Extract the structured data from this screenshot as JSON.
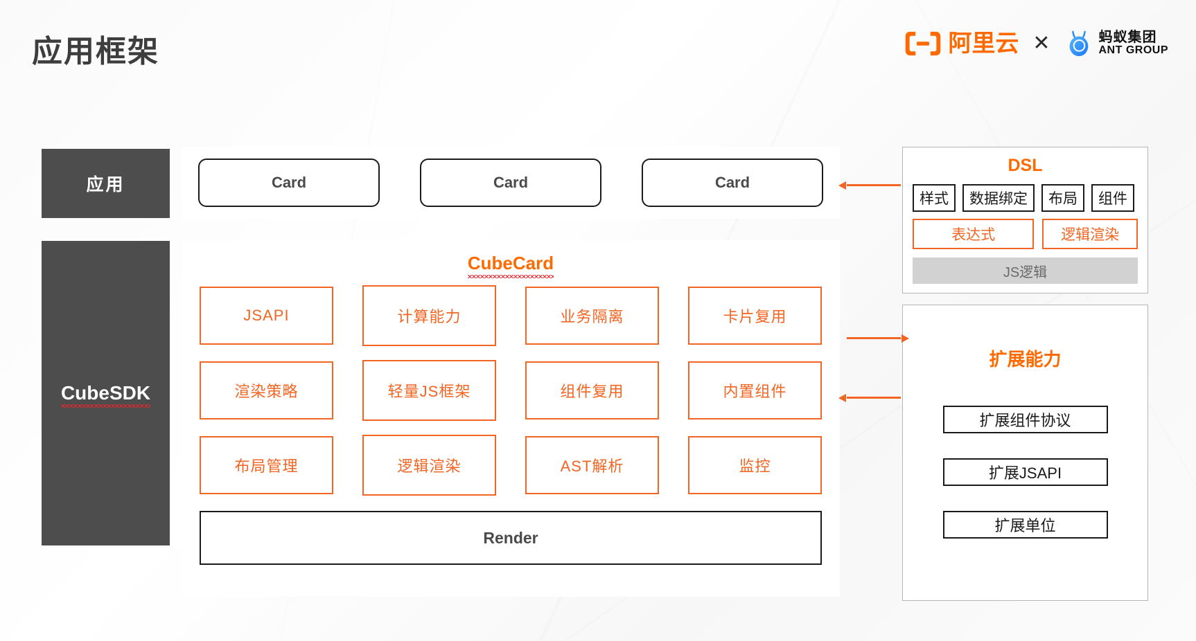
{
  "header": {
    "title": "应用框架",
    "brands": {
      "alibaba_cloud": "阿里云",
      "separator": "✕",
      "ant_cn": "蚂蚁集团",
      "ant_en": "ANT GROUP"
    }
  },
  "rails": {
    "app": "应用",
    "sdk": "CubeSDK"
  },
  "cards": {
    "items": [
      "Card",
      "Card",
      "Card"
    ]
  },
  "cube": {
    "title": "CubeCard",
    "rows": [
      [
        "JSAPI",
        "计算能力",
        "业务隔离",
        "卡片复用"
      ],
      [
        "渲染策略",
        "轻量JS框架",
        "组件复用",
        "内置组件"
      ],
      [
        "布局管理",
        "逻辑渲染",
        "AST解析",
        "监控"
      ]
    ],
    "render": "Render"
  },
  "dsl": {
    "title": "DSL",
    "chips_black": [
      "样式",
      "数据绑定",
      "布局",
      "组件"
    ],
    "chips_orange": [
      "表达式",
      "逻辑渲染"
    ],
    "js_bar": "JS逻辑"
  },
  "extension": {
    "title": "扩展能力",
    "items": [
      "扩展组件协议",
      "扩展JSAPI",
      "扩展单位"
    ]
  },
  "colors": {
    "orange": "#f26522",
    "orange_bright": "#ff6a00",
    "dark_rail": "#4d4d4d",
    "black_border": "#1a1a1a",
    "gray_bar": "#d2d2d2",
    "panel_border": "#b5b5b5",
    "squiggle_red": "#e8262a"
  },
  "icons": {
    "alibaba_cloud_mark": "alibaba-cloud-logo-icon",
    "ant_group_mark": "ant-group-logo-icon",
    "cross": "cross-separator-icon",
    "arrow_to_cards": "arrow-left-icon",
    "arrow_to_extension": "arrow-right-icon",
    "arrow_from_extension": "arrow-left-icon"
  }
}
